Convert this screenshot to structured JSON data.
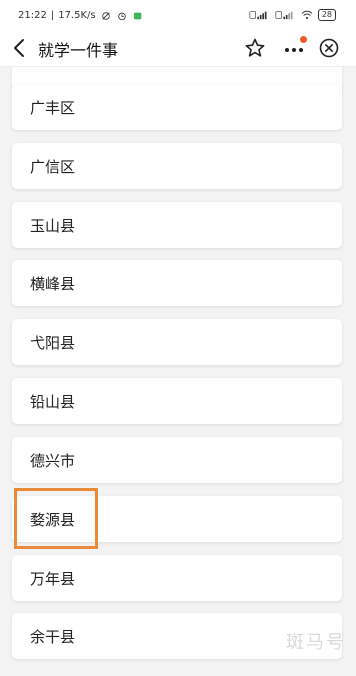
{
  "status_bar": {
    "time": "21:22",
    "speed": "17.5K/s",
    "battery": "28"
  },
  "nav": {
    "title": "就学一件事"
  },
  "list": {
    "items": [
      {
        "label": "广丰区"
      },
      {
        "label": "广信区"
      },
      {
        "label": "玉山县"
      },
      {
        "label": "横峰县"
      },
      {
        "label": "弋阳县"
      },
      {
        "label": "铅山县"
      },
      {
        "label": "德兴市"
      },
      {
        "label": "婺源县"
      },
      {
        "label": "万年县"
      },
      {
        "label": "余干县"
      }
    ]
  },
  "watermark": "斑马号",
  "colors": {
    "highlight_border": "#e9893a",
    "notification_dot": "#f05a2a",
    "page_background": "#f3f3f3"
  }
}
